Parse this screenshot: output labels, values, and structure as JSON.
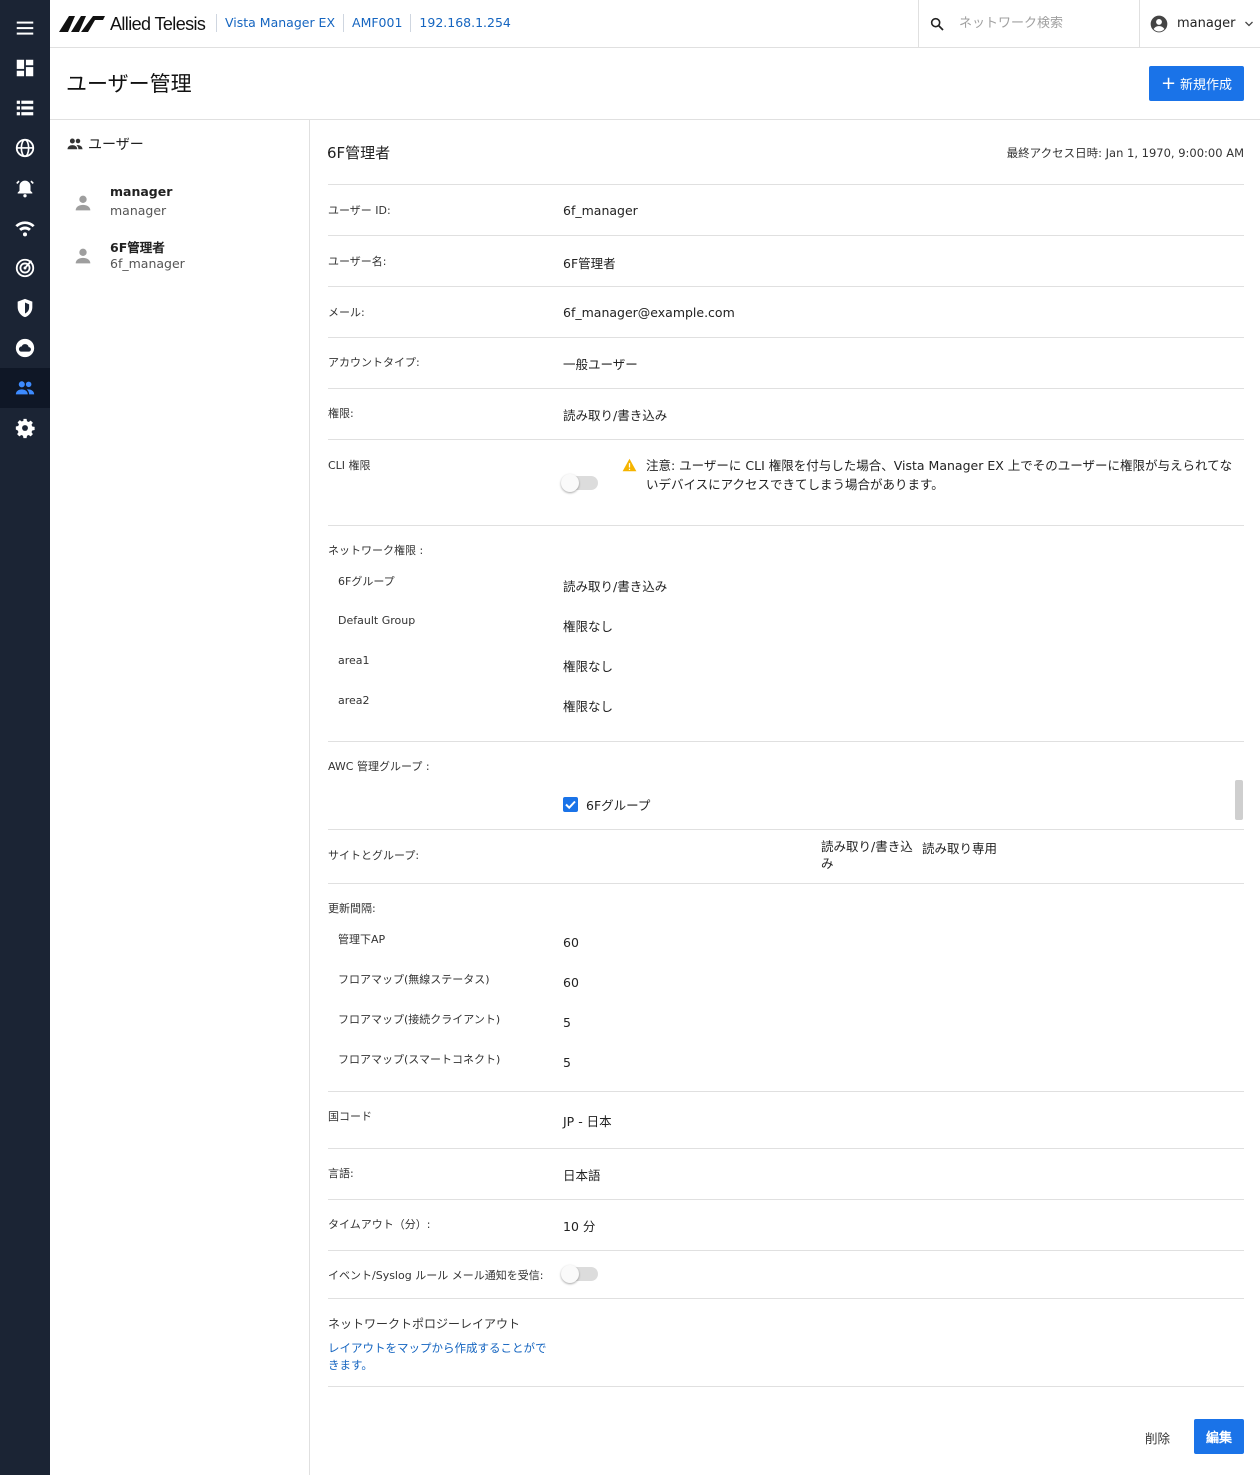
{
  "header": {
    "brand": "Allied Telesis",
    "breadcrumbs": [
      "Vista Manager EX",
      "AMF001",
      "192.168.1.254"
    ],
    "search_placeholder": "ネットワーク検索",
    "user": "manager"
  },
  "page": {
    "title": "ユーザー管理",
    "new_button": "新規作成"
  },
  "user_list": {
    "header": "ユーザー",
    "users": [
      {
        "name": "manager",
        "id": "manager"
      },
      {
        "name": "6F管理者",
        "id": "6f_manager"
      }
    ]
  },
  "detail": {
    "title": "6F管理者",
    "last_access": "最終アクセス日時: Jan 1, 1970, 9:00:00 AM",
    "user_id_label": "ユーザー ID:",
    "user_id": "6f_manager",
    "username_label": "ユーザー名:",
    "username": "6F管理者",
    "email_label": "メール:",
    "email": "6f_manager@example.com",
    "account_type_label": "アカウントタイプ:",
    "account_type": "一般ユーザー",
    "permission_label": "権限:",
    "permission": "読み取り/書き込み",
    "cli_label": "CLI 権限",
    "cli_warning": "注意: ユーザーに CLI 権限を付与した場合、Vista Manager EX 上でそのユーザーに権限が与えられてないデバイスにアクセスできてしまう場合があります。",
    "network_perm_label": "ネットワーク権限 :",
    "network_perms": [
      {
        "group": "6Fグループ",
        "perm": "読み取り/書き込み"
      },
      {
        "group": "Default Group",
        "perm": "権限なし"
      },
      {
        "group": "area1",
        "perm": "権限なし"
      },
      {
        "group": "area2",
        "perm": "権限なし"
      }
    ],
    "awc_label": "AWC 管理グループ :",
    "awc_group": "6Fグループ",
    "sites_label": "サイトとグループ:",
    "sites_col1": "読み取り/書き込み",
    "sites_col2": "読み取り専用",
    "update_label": "更新間隔:",
    "update_intervals": [
      {
        "name": "管理下AP",
        "value": "60"
      },
      {
        "name": "フロアマップ(無線ステータス)",
        "value": "60"
      },
      {
        "name": "フロアマップ(接続クライアント)",
        "value": "5"
      },
      {
        "name": "フロアマップ(スマートコネクト)",
        "value": "5"
      }
    ],
    "country_label": "国コード",
    "country": "JP - 日本",
    "language_label": "言語:",
    "language": "日本語",
    "timeout_label": "タイムアウト（分）:",
    "timeout": "10 分",
    "event_label": "イベント/Syslog ルール メール通知を受信:",
    "topology_label": "ネットワークトポロジーレイアウト",
    "topology_link": "レイアウトをマップから作成することができます。",
    "delete_button": "削除",
    "edit_button": "編集"
  },
  "colors": {
    "sidebar": "#1b2434",
    "accent": "#1a73e8",
    "warning": "#f5b400"
  }
}
